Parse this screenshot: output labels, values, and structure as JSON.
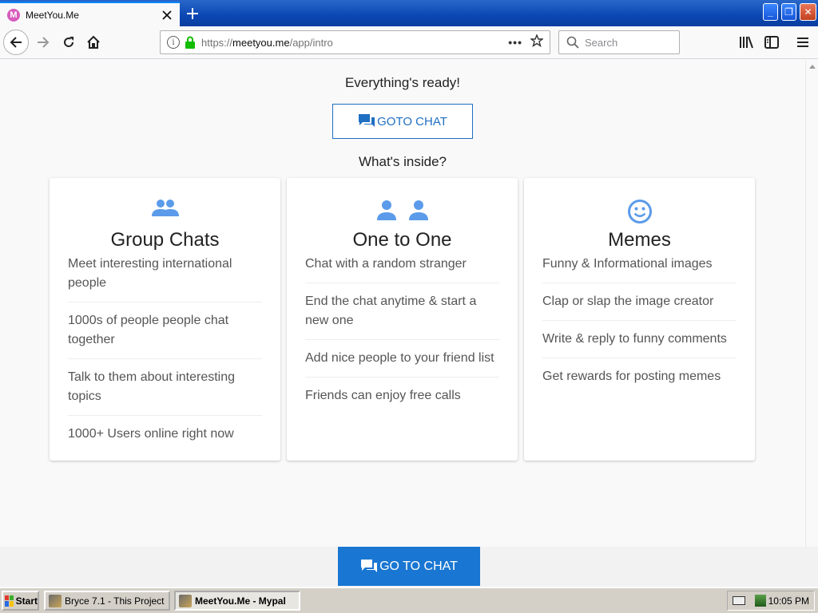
{
  "browser": {
    "tab_title": "MeetYou.Me",
    "favicon_letter": "M",
    "url_scheme": "https://",
    "url_host": "meetyou.me",
    "url_path": "/app/intro",
    "search_placeholder": "Search",
    "more_glyph": "•••",
    "win_min": "_",
    "win_max": "❐",
    "win_close": "✕"
  },
  "page": {
    "ready_text": "Everything's ready!",
    "goto_outline_label": "GOTO CHAT",
    "inside_text": "What's inside?",
    "goto_solid_label": "GO TO CHAT",
    "accent_color": "#1976d2",
    "icon_color": "#5b9bea"
  },
  "cards": [
    {
      "title": "Group Chats",
      "icon": "group-icon",
      "items": [
        "Meet interesting international people",
        "1000s of people people chat together",
        "Talk to them about interesting topics",
        "1000+ Users online right now"
      ]
    },
    {
      "title": "One to One",
      "icon": "two-people-icon",
      "items": [
        "Chat with a random stranger",
        "End the chat anytime & start a new one",
        "Add nice people to your friend list",
        "Friends can enjoy free calls"
      ]
    },
    {
      "title": "Memes",
      "icon": "smiley-icon",
      "items": [
        "Funny & Informational images",
        "Clap or slap the image creator",
        "Write & reply to funny comments",
        "Get rewards for posting memes"
      ]
    }
  ],
  "taskbar": {
    "start_label": "Start",
    "tasks": [
      "Bryce 7.1 - This Project",
      "MeetYou.Me - Mypal"
    ],
    "clock": "10:05 PM"
  }
}
